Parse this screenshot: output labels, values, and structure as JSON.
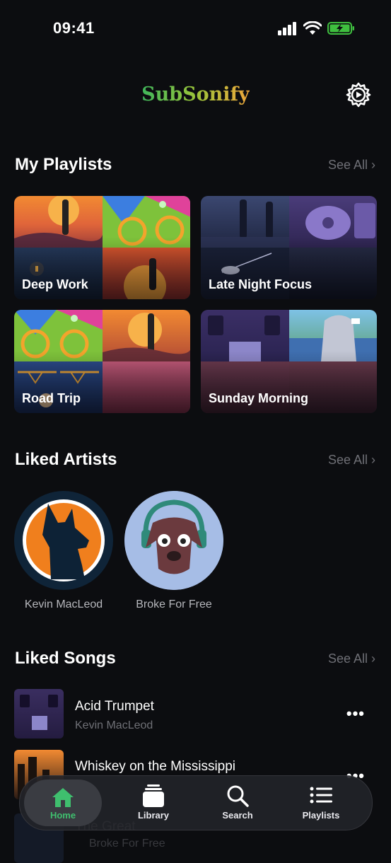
{
  "status": {
    "time": "09:41"
  },
  "header": {
    "app_name": "SubSonify"
  },
  "playlists": {
    "title": "My Playlists",
    "see_all": "See All ›",
    "items": [
      {
        "name": "Deep Work"
      },
      {
        "name": "Late Night Focus"
      },
      {
        "name": "Road Trip"
      },
      {
        "name": "Sunday Morning"
      }
    ]
  },
  "artists": {
    "title": "Liked Artists",
    "see_all": "See All ›",
    "items": [
      {
        "name": "Kevin MacLeod"
      },
      {
        "name": "Broke For Free"
      }
    ]
  },
  "songs": {
    "title": "Liked Songs",
    "see_all": "See All ›",
    "items": [
      {
        "title": "Acid Trumpet",
        "artist": "Kevin MacLeod"
      },
      {
        "title": "Whiskey on the Mississippi",
        "artist": ""
      },
      {
        "title": "The Great",
        "artist": "Broke For Free"
      }
    ]
  },
  "tabbar": {
    "tabs": [
      {
        "label": "Home",
        "icon": "home-icon",
        "active": true
      },
      {
        "label": "Library",
        "icon": "library-icon"
      },
      {
        "label": "Search",
        "icon": "search-icon"
      },
      {
        "label": "Playlists",
        "icon": "playlists-icon"
      }
    ]
  },
  "colors": {
    "background": "#0c0d10",
    "accent": "#3fbf6e",
    "muted": "#6f7076"
  }
}
